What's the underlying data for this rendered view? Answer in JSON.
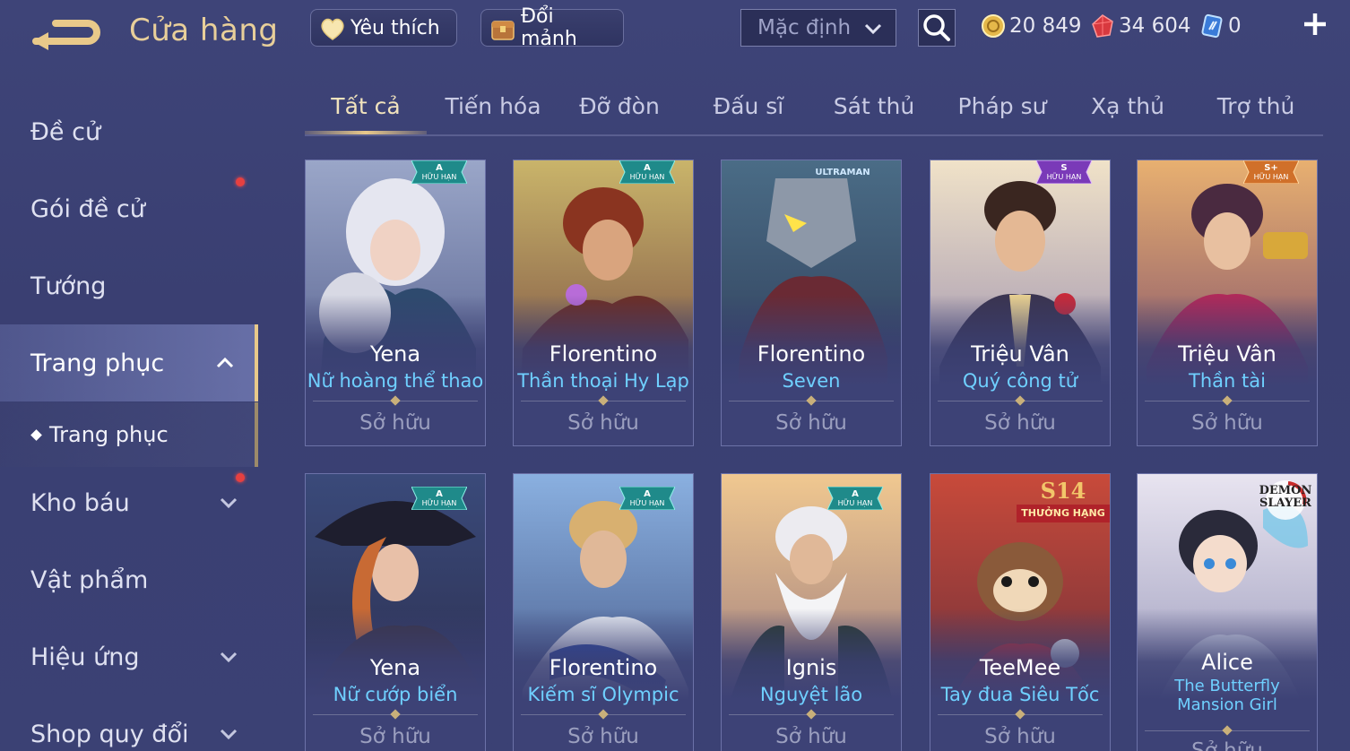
{
  "header": {
    "title": "Cửa hàng",
    "favorite_label": "Yêu thích",
    "shard_label": "Đổi mảnh",
    "sort_value": "Mặc định",
    "currencies": {
      "gold": "20 849",
      "ruby": "34 604",
      "voucher": "0"
    }
  },
  "sidebar": {
    "items": [
      {
        "label": "Đề cử"
      },
      {
        "label": "Gói đề cử"
      },
      {
        "label": "Tướng"
      },
      {
        "label": "Trang phục"
      },
      {
        "label": "Trang phục"
      },
      {
        "label": "Kho báu"
      },
      {
        "label": "Vật phẩm"
      },
      {
        "label": "Hiệu ứng"
      },
      {
        "label": "Shop quy đổi"
      }
    ]
  },
  "tabs": [
    "Tất cả",
    "Tiến hóa",
    "Đỡ đòn",
    "Đấu sĩ",
    "Sát thủ",
    "Pháp sư",
    "Xạ thủ",
    "Trợ thủ"
  ],
  "cards": [
    {
      "hero": "Yena",
      "skin": "Nữ hoàng thể thao",
      "status": "Sở hữu",
      "badge_tier": "A",
      "badge_text": "HỮU HẠN"
    },
    {
      "hero": "Florentino",
      "skin": "Thần thoại Hy Lạp",
      "status": "Sở hữu",
      "badge_tier": "A",
      "badge_text": "HỮU HẠN"
    },
    {
      "hero": "Florentino",
      "skin": "Seven",
      "status": "Sở hữu",
      "badge_tier": "",
      "badge_text": "ULTRAMAN"
    },
    {
      "hero": "Triệu Vân",
      "skin": "Quý công tử",
      "status": "Sở hữu",
      "badge_tier": "S",
      "badge_text": "HỮU HẠN"
    },
    {
      "hero": "Triệu Vân",
      "skin": "Thần tài",
      "status": "Sở hữu",
      "badge_tier": "S+",
      "badge_text": "HỮU HẠN"
    },
    {
      "hero": "Yena",
      "skin": "Nữ cướp biển",
      "status": "Sở hữu",
      "badge_tier": "A",
      "badge_text": "HỮU HẠN"
    },
    {
      "hero": "Florentino",
      "skin": "Kiếm sĩ Olympic",
      "status": "Sở hữu",
      "badge_tier": "A",
      "badge_text": "HỮU HẠN"
    },
    {
      "hero": "Ignis",
      "skin": "Nguyệt lão",
      "status": "Sở hữu",
      "badge_tier": "A",
      "badge_text": "HỮU HẠN"
    },
    {
      "hero": "TeeMee",
      "skin": "Tay đua Siêu Tốc",
      "status": "Sở hữu",
      "badge_tier": "S14",
      "badge_text": "THƯỞNG HẠNG"
    },
    {
      "hero": "Alice",
      "skin": "The Butterfly Mansion Girl",
      "status": "Sở hữu",
      "badge_tier": "",
      "badge_text": "DEMON SLAYER"
    }
  ],
  "colors": {
    "accent_gold": "#e9c98a",
    "skin_name_blue": "#6fd0ff",
    "badge_teal": "#1f8a8a",
    "badge_purple": "#7a3ab8",
    "badge_orange": "#d0702a",
    "notification_red": "#e64040"
  },
  "icons": {
    "back": "back-arrow-icon",
    "favorite": "heart-icon",
    "shard": "chest-icon",
    "search": "search-icon",
    "gold": "gold-coin-icon",
    "ruby": "ruby-gem-icon",
    "voucher": "voucher-icon",
    "add": "plus-icon"
  }
}
